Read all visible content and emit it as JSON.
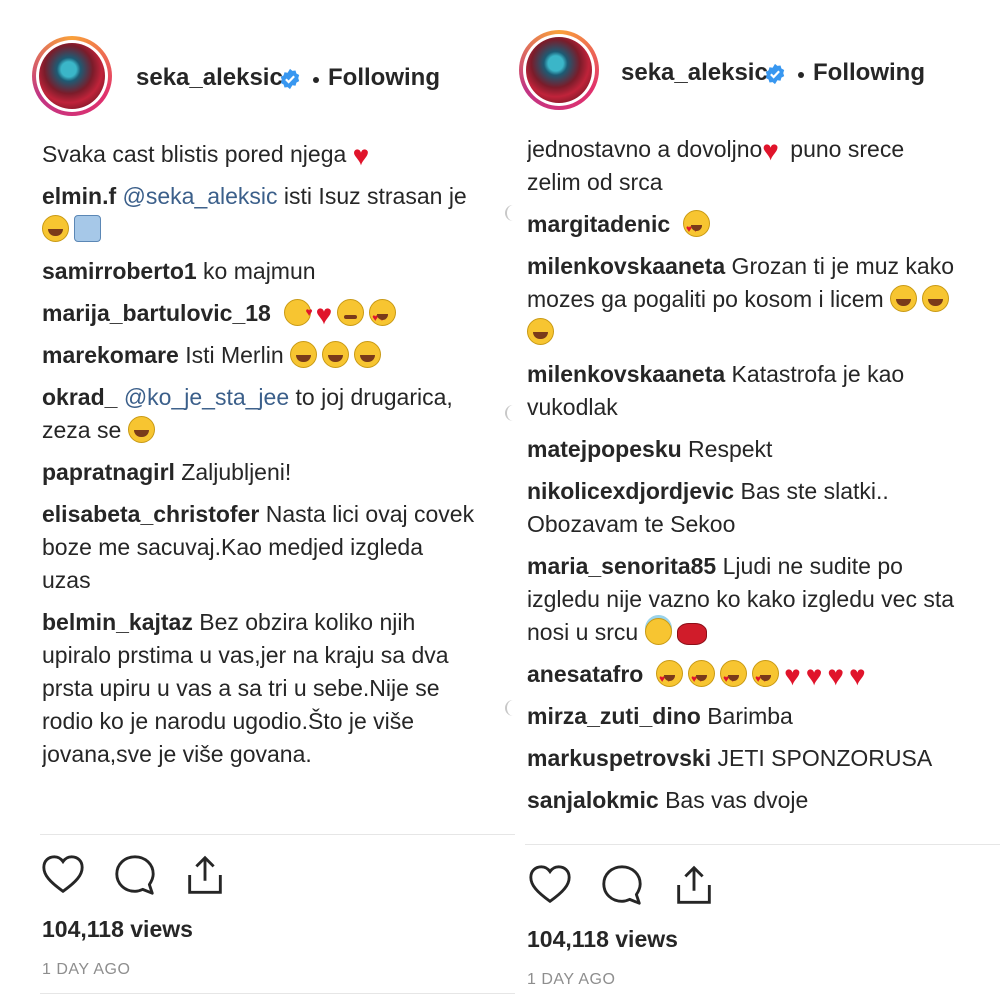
{
  "left": {
    "username": "seka_aleksic",
    "follow_label": "Following",
    "first_comment_partial": "Svaka cast blistis pored njega",
    "comments": [
      {
        "user": "elmin.f",
        "mention": "@seka_aleksic",
        "text": " isti Isuz strasan je"
      },
      {
        "user": "samirroberto1",
        "text": " ko majmun"
      },
      {
        "user": "marija_bartulovic_18",
        "text": ""
      },
      {
        "user": "marekomare",
        "text": " Isti Merlin"
      },
      {
        "user": "okrad_",
        "mention": "@ko_je_sta_jee",
        "text": " to joj drugarica, zeza se"
      },
      {
        "user": "papratnagirl",
        "text": " Zaljubljeni!"
      },
      {
        "user": "elisabeta_christofer",
        "text": " Nasta lici ovaj covek boze me sacuvaj.Kao medjed izgleda uzas"
      },
      {
        "user": "belmin_kajtaz",
        "text": " Bez obzira koliko njih upiralo prstima u vas,jer na kraju sa dva prsta upiru u vas a sa tri u sebe.Nije se rodio ko je narodu ugodio.Što je više jovana,sve je više govana."
      }
    ],
    "views": "104,118 views",
    "time_ago": "1 DAY AGO"
  },
  "right": {
    "username": "seka_aleksic",
    "follow_label": "Following",
    "first_comment_partial_line1": "jednostavno a dovoljno",
    "first_comment_partial_line1b": " puno srece",
    "first_comment_partial_line2": "zelim od srca",
    "comments": [
      {
        "user": "margitadenic",
        "text": ""
      },
      {
        "user": "milenkovskaaneta",
        "text": " Grozan ti je muz kako mozes ga pogaliti po kosom i licem"
      },
      {
        "user": "milenkovskaaneta",
        "text": " Katastrofa je kao vukodlak"
      },
      {
        "user": "matejpopesku",
        "text": " Respekt"
      },
      {
        "user": "nikolicexdjordjevic",
        "text": " Bas ste slatki.. Obozavam te Sekoo"
      },
      {
        "user": "maria_senorita85",
        "text": " Ljudi ne sudite po izgledu nije vazno ko kako izgledu vec sta nosi u srcu"
      },
      {
        "user": "anesatafro",
        "text": ""
      },
      {
        "user": "mirza_zuti_dino",
        "text": " Barimba"
      },
      {
        "user": "markuspetrovski",
        "text": " JETI SPONZORUSA"
      },
      {
        "user": "sanjalokmic",
        "text": " Bas vas dvoje"
      }
    ],
    "views": "104,118 views",
    "time_ago": "1 DAY AGO"
  },
  "icons": {
    "like": "heart-outline-icon",
    "comment": "speech-bubble-icon",
    "share": "share-upload-icon",
    "verified": "verified-badge-icon"
  },
  "colors": {
    "verified_blue": "#3897f0",
    "mention": "#3b5f8a",
    "heart_red": "#e0142b"
  }
}
